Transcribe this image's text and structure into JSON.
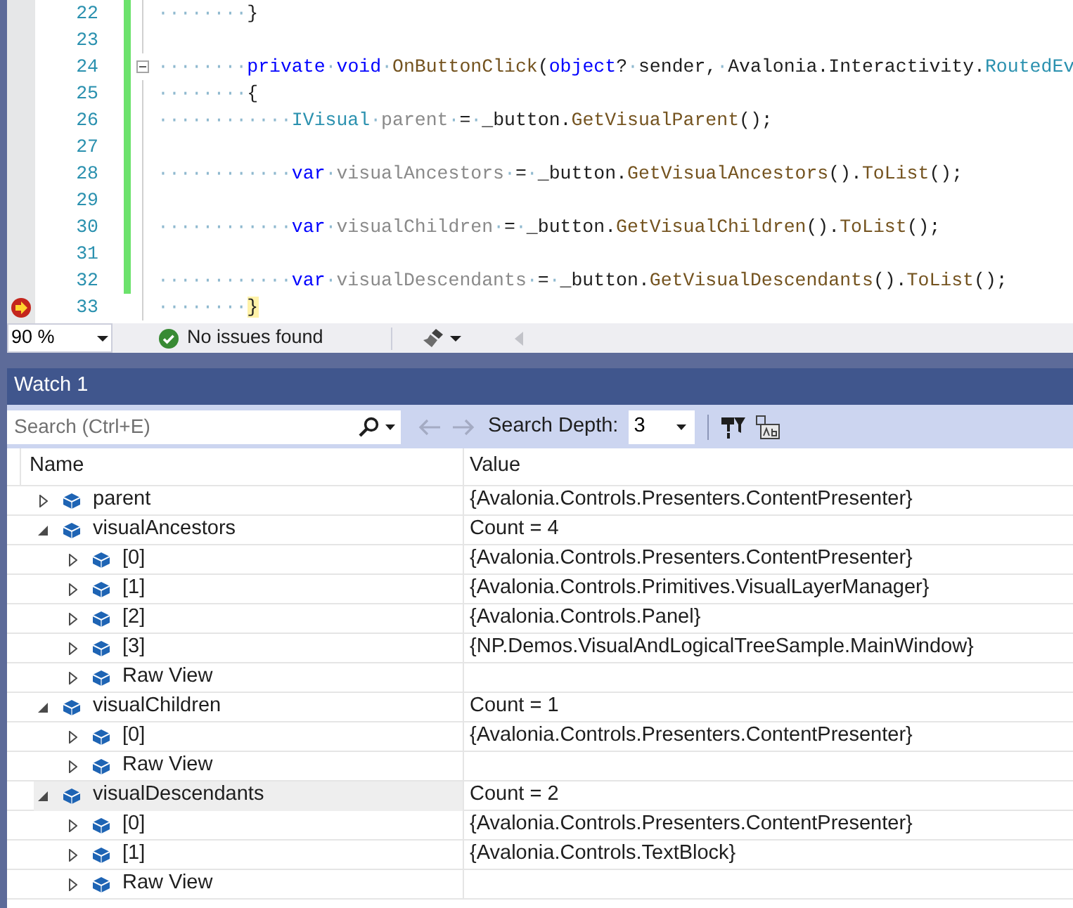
{
  "editor": {
    "lines": [
      {
        "number": "22",
        "changed": true,
        "collapse": false,
        "current": false,
        "tokens": [
          {
            "kind": "ws",
            "text": "········"
          },
          {
            "kind": "plain",
            "text": "}"
          }
        ]
      },
      {
        "number": "23",
        "changed": true,
        "collapse": false,
        "current": false
      },
      {
        "number": "24",
        "changed": true,
        "collapse": true,
        "current": false,
        "tokens": [
          {
            "kind": "ws",
            "text": "········"
          },
          {
            "kind": "keyword",
            "text": "private"
          },
          {
            "kind": "ws",
            "text": "·"
          },
          {
            "kind": "keyword",
            "text": "void"
          },
          {
            "kind": "ws",
            "text": "·"
          },
          {
            "kind": "method",
            "text": "OnButtonClick"
          },
          {
            "kind": "plain",
            "text": "("
          },
          {
            "kind": "keyword",
            "text": "object"
          },
          {
            "kind": "plain",
            "text": "?"
          },
          {
            "kind": "ws",
            "text": "·"
          },
          {
            "kind": "plain",
            "text": "sender,"
          },
          {
            "kind": "ws",
            "text": "·"
          },
          {
            "kind": "plain",
            "text": "Avalonia.Interactivity."
          },
          {
            "kind": "type",
            "text": "RoutedEv"
          }
        ]
      },
      {
        "number": "25",
        "changed": true,
        "collapse": false,
        "current": false,
        "tokens": [
          {
            "kind": "ws",
            "text": "········"
          },
          {
            "kind": "plain",
            "text": "{"
          }
        ]
      },
      {
        "number": "26",
        "changed": true,
        "collapse": false,
        "current": false,
        "tokens": [
          {
            "kind": "ws",
            "text": "············"
          },
          {
            "kind": "type",
            "text": "IVisual"
          },
          {
            "kind": "ws",
            "text": "·"
          },
          {
            "kind": "unused",
            "text": "parent"
          },
          {
            "kind": "ws",
            "text": "·"
          },
          {
            "kind": "plain",
            "text": "="
          },
          {
            "kind": "ws",
            "text": "·"
          },
          {
            "kind": "plain",
            "text": "_button."
          },
          {
            "kind": "method",
            "text": "GetVisualParent"
          },
          {
            "kind": "plain",
            "text": "();"
          }
        ]
      },
      {
        "number": "27",
        "changed": true,
        "collapse": false,
        "current": false
      },
      {
        "number": "28",
        "changed": true,
        "collapse": false,
        "current": false,
        "tokens": [
          {
            "kind": "ws",
            "text": "············"
          },
          {
            "kind": "keyword",
            "text": "var"
          },
          {
            "kind": "ws",
            "text": "·"
          },
          {
            "kind": "unused",
            "text": "visualAncestors"
          },
          {
            "kind": "ws",
            "text": "·"
          },
          {
            "kind": "plain",
            "text": "="
          },
          {
            "kind": "ws",
            "text": "·"
          },
          {
            "kind": "plain",
            "text": "_button."
          },
          {
            "kind": "method",
            "text": "GetVisualAncestors"
          },
          {
            "kind": "plain",
            "text": "()."
          },
          {
            "kind": "method",
            "text": "ToList"
          },
          {
            "kind": "plain",
            "text": "();"
          }
        ]
      },
      {
        "number": "29",
        "changed": true,
        "collapse": false,
        "current": false
      },
      {
        "number": "30",
        "changed": true,
        "collapse": false,
        "current": false,
        "tokens": [
          {
            "kind": "ws",
            "text": "············"
          },
          {
            "kind": "keyword",
            "text": "var"
          },
          {
            "kind": "ws",
            "text": "·"
          },
          {
            "kind": "unused",
            "text": "visualChildren"
          },
          {
            "kind": "ws",
            "text": "·"
          },
          {
            "kind": "plain",
            "text": "="
          },
          {
            "kind": "ws",
            "text": "·"
          },
          {
            "kind": "plain",
            "text": "_button."
          },
          {
            "kind": "method",
            "text": "GetVisualChildren"
          },
          {
            "kind": "plain",
            "text": "()."
          },
          {
            "kind": "method",
            "text": "ToList"
          },
          {
            "kind": "plain",
            "text": "();"
          }
        ]
      },
      {
        "number": "31",
        "changed": true,
        "collapse": false,
        "current": false
      },
      {
        "number": "32",
        "changed": true,
        "collapse": false,
        "current": false,
        "tokens": [
          {
            "kind": "ws",
            "text": "············"
          },
          {
            "kind": "keyword",
            "text": "var"
          },
          {
            "kind": "ws",
            "text": "·"
          },
          {
            "kind": "unused",
            "text": "visualDescendants"
          },
          {
            "kind": "ws",
            "text": "·"
          },
          {
            "kind": "plain",
            "text": "="
          },
          {
            "kind": "ws",
            "text": "·"
          },
          {
            "kind": "plain",
            "text": "_button."
          },
          {
            "kind": "method",
            "text": "GetVisualDescendants"
          },
          {
            "kind": "plain",
            "text": "()."
          },
          {
            "kind": "method",
            "text": "ToList"
          },
          {
            "kind": "plain",
            "text": "();"
          }
        ]
      },
      {
        "number": "33",
        "changed": false,
        "collapse": false,
        "current": true,
        "tokens": [
          {
            "kind": "ws",
            "text": "········"
          },
          {
            "kind": "highlight",
            "text": "}"
          }
        ]
      }
    ]
  },
  "status_bar": {
    "zoom": "90 %",
    "issues": "No issues found"
  },
  "watch": {
    "title": "Watch 1",
    "search": {
      "placeholder": "Search (Ctrl+E)"
    },
    "depth_label": "Search Depth:",
    "depth": "3",
    "columns": [
      "Name",
      "Value"
    ],
    "rows": [
      {
        "name": "parent",
        "value": "{Avalonia.Controls.Presenters.ContentPresenter}",
        "expanded": false,
        "selected": false
      },
      {
        "name": "visualAncestors",
        "value": "Count = 4",
        "expanded": true,
        "selected": false,
        "children": [
          {
            "name": "[0]",
            "value": "{Avalonia.Controls.Presenters.ContentPresenter}",
            "expanded": false,
            "selected": false
          },
          {
            "name": "[1]",
            "value": "{Avalonia.Controls.Primitives.VisualLayerManager}",
            "expanded": false,
            "selected": false
          },
          {
            "name": "[2]",
            "value": "{Avalonia.Controls.Panel}",
            "expanded": false,
            "selected": false
          },
          {
            "name": "[3]",
            "value": "{NP.Demos.VisualAndLogicalTreeSample.MainWindow}",
            "expanded": false,
            "selected": false
          },
          {
            "name": "Raw View",
            "expanded": false,
            "selected": false
          }
        ]
      },
      {
        "name": "visualChildren",
        "value": "Count = 1",
        "expanded": true,
        "selected": false,
        "children": [
          {
            "name": "[0]",
            "value": "{Avalonia.Controls.Presenters.ContentPresenter}",
            "expanded": false,
            "selected": false
          },
          {
            "name": "Raw View",
            "expanded": false,
            "selected": false
          }
        ]
      },
      {
        "name": "visualDescendants",
        "value": "Count = 2",
        "expanded": true,
        "selected": true,
        "children": [
          {
            "name": "[0]",
            "value": "{Avalonia.Controls.Presenters.ContentPresenter}",
            "expanded": false,
            "selected": false
          },
          {
            "name": "[1]",
            "value": "{Avalonia.Controls.TextBlock}",
            "expanded": false,
            "selected": false
          },
          {
            "name": "Raw View",
            "expanded": false,
            "selected": false
          }
        ]
      }
    ]
  }
}
